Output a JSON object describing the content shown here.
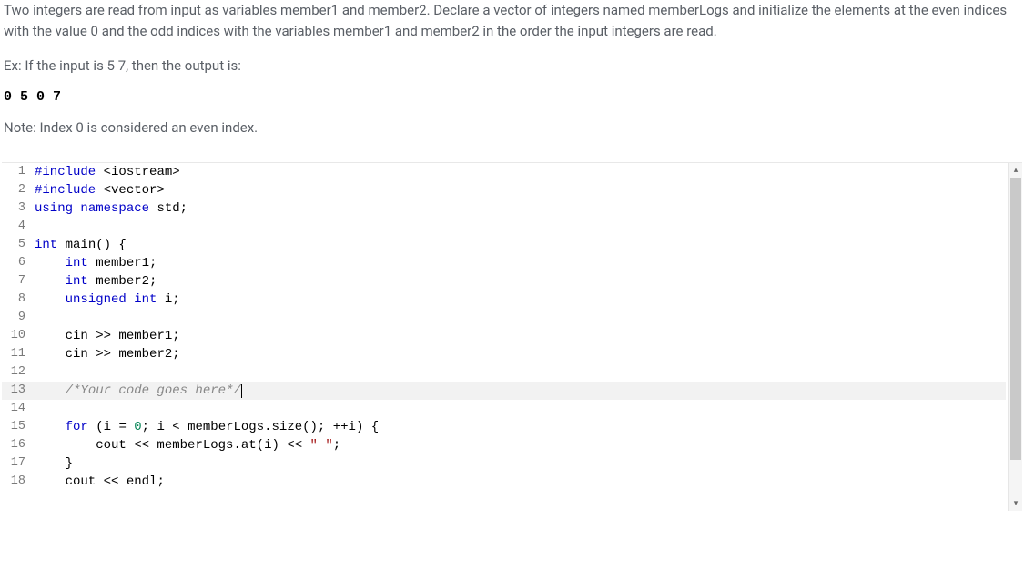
{
  "prompt": {
    "p1": "Two integers are read from input as variables member1 and member2. Declare a vector of integers named memberLogs and initialize the elements at the even indices with the value 0 and the odd indices with the variables member1 and member2 in the order the input integers are read.",
    "p2": "Ex: If the input is 5 7, then the output is:",
    "sample_output": "0 5 0 7",
    "note": "Note: Index 0 is considered an even index."
  },
  "code": {
    "lines": [
      {
        "n": 1,
        "tokens": [
          [
            "pp",
            "#include "
          ],
          [
            "op",
            "<"
          ],
          [
            "ident",
            "iostream"
          ],
          [
            "op",
            ">"
          ]
        ]
      },
      {
        "n": 2,
        "tokens": [
          [
            "pp",
            "#include "
          ],
          [
            "op",
            "<"
          ],
          [
            "ident",
            "vector"
          ],
          [
            "op",
            ">"
          ]
        ]
      },
      {
        "n": 3,
        "tokens": [
          [
            "kw",
            "using "
          ],
          [
            "kw",
            "namespace "
          ],
          [
            "ident",
            "std"
          ],
          [
            "op",
            ";"
          ]
        ]
      },
      {
        "n": 4,
        "tokens": []
      },
      {
        "n": 5,
        "tokens": [
          [
            "type",
            "int "
          ],
          [
            "ident",
            "main"
          ],
          [
            "op",
            "() {"
          ]
        ]
      },
      {
        "n": 6,
        "tokens": [
          [
            "ident",
            "    "
          ],
          [
            "type",
            "int "
          ],
          [
            "ident",
            "member1"
          ],
          [
            "op",
            ";"
          ]
        ]
      },
      {
        "n": 7,
        "tokens": [
          [
            "ident",
            "    "
          ],
          [
            "type",
            "int "
          ],
          [
            "ident",
            "member2"
          ],
          [
            "op",
            ";"
          ]
        ]
      },
      {
        "n": 8,
        "tokens": [
          [
            "ident",
            "    "
          ],
          [
            "type",
            "unsigned int "
          ],
          [
            "ident",
            "i"
          ],
          [
            "op",
            ";"
          ]
        ]
      },
      {
        "n": 9,
        "tokens": []
      },
      {
        "n": 10,
        "tokens": [
          [
            "ident",
            "    cin "
          ],
          [
            "op",
            ">>"
          ],
          [
            "ident",
            " member1"
          ],
          [
            "op",
            ";"
          ]
        ]
      },
      {
        "n": 11,
        "tokens": [
          [
            "ident",
            "    cin "
          ],
          [
            "op",
            ">>"
          ],
          [
            "ident",
            " member2"
          ],
          [
            "op",
            ";"
          ]
        ]
      },
      {
        "n": 12,
        "tokens": []
      },
      {
        "n": 13,
        "highlight": true,
        "tokens": [
          [
            "ident",
            "    "
          ],
          [
            "cmt",
            "/*Your code goes here*/"
          ]
        ],
        "cursor": true
      },
      {
        "n": 14,
        "tokens": []
      },
      {
        "n": 15,
        "tokens": [
          [
            "ident",
            "    "
          ],
          [
            "kw",
            "for "
          ],
          [
            "op",
            "("
          ],
          [
            "ident",
            "i "
          ],
          [
            "op",
            "="
          ],
          [
            "ident",
            " "
          ],
          [
            "num",
            "0"
          ],
          [
            "op",
            "; "
          ],
          [
            "ident",
            "i "
          ],
          [
            "op",
            "<"
          ],
          [
            "ident",
            " memberLogs"
          ],
          [
            "op",
            "."
          ],
          [
            "ident",
            "size"
          ],
          [
            "op",
            "(); ++"
          ],
          [
            "ident",
            "i"
          ],
          [
            "op",
            ") {"
          ]
        ]
      },
      {
        "n": 16,
        "tokens": [
          [
            "ident",
            "        cout "
          ],
          [
            "op",
            "<<"
          ],
          [
            "ident",
            " memberLogs"
          ],
          [
            "op",
            "."
          ],
          [
            "ident",
            "at"
          ],
          [
            "op",
            "("
          ],
          [
            "ident",
            "i"
          ],
          [
            "op",
            ") "
          ],
          [
            "op",
            "<<"
          ],
          [
            "ident",
            " "
          ],
          [
            "str",
            "\" \""
          ],
          [
            "op",
            ";"
          ]
        ]
      },
      {
        "n": 17,
        "tokens": [
          [
            "ident",
            "    "
          ],
          [
            "op",
            "}"
          ]
        ]
      },
      {
        "n": 18,
        "tokens": [
          [
            "ident",
            "    cout "
          ],
          [
            "op",
            "<<"
          ],
          [
            "ident",
            " endl"
          ],
          [
            "op",
            ";"
          ]
        ]
      }
    ]
  }
}
